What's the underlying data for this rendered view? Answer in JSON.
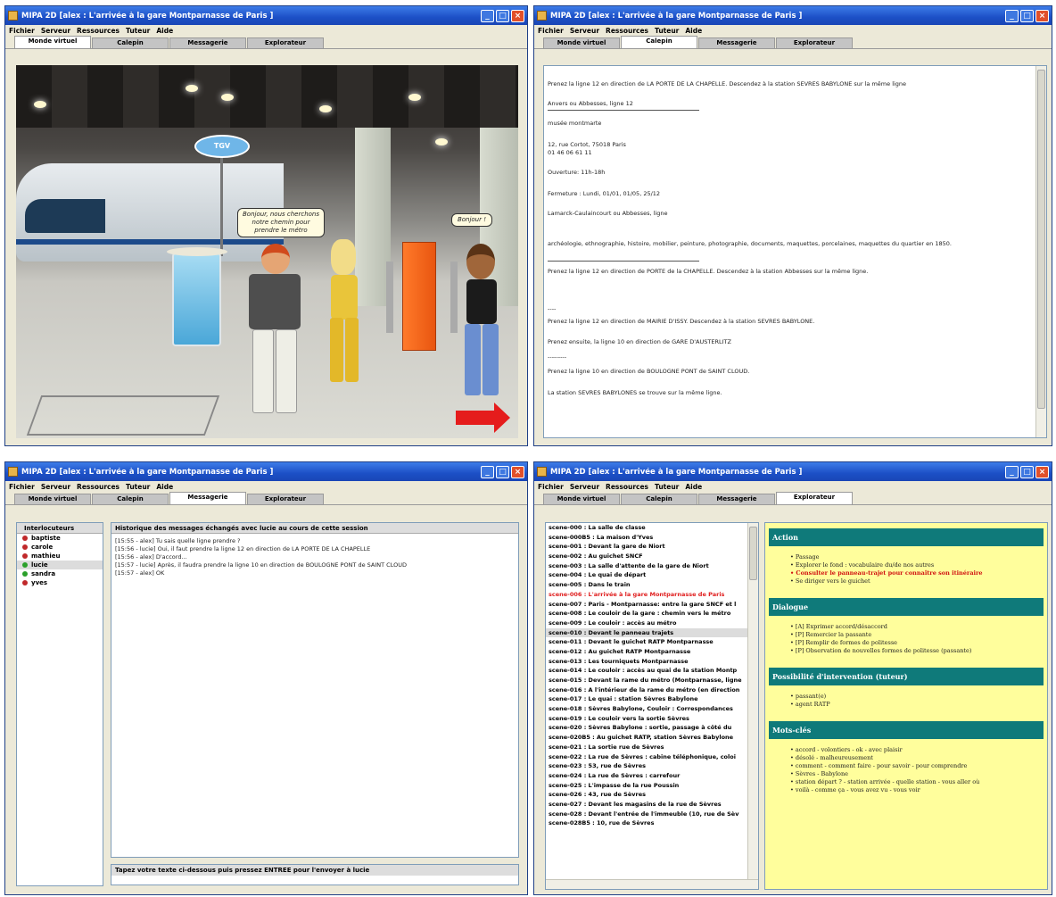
{
  "window_title": "MIPA 2D [alex : L'arrivée à la gare Montparnasse de Paris ]",
  "menu": [
    "Fichier",
    "Serveur",
    "Ressources",
    "Tuteur",
    "Aide"
  ],
  "tabs": [
    "Monde virtuel",
    "Calepin",
    "Messagerie",
    "Explorateur"
  ],
  "scene": {
    "sign": "TGV",
    "bubble_left": "Bonjour, nous cherchons notre chemin pour prendre le métro",
    "bubble_right": "Bonjour !"
  },
  "calepin": {
    "lines": [
      "Prenez la ligne 12 en direction de LA PORTE DE LA CHAPELLE. Descendez à la station SEVRES BABYLONE sur la même ligne",
      "Anvers ou Abbesses, ligne 12",
      "musée montmarte",
      "12, rue Cortot, 75018 Paris",
      "01 46 06 61 11",
      "Ouverture: 11h-18h",
      "Fermeture : Lundi, 01/01, 01/05, 25/12",
      "Lamarck-Caulaincourt ou Abbesses, ligne",
      "archéologie, ethnographie, histoire, mobilier, peinture, photographie, documents, maquettes, porcelaines, maquettes du quartier en 1850.",
      "Prenez la ligne 12 en direction de PORTE de la CHAPELLE. Descendez à la station Abbesses sur la même ligne.",
      "----",
      "Prenez la ligne 12 en direction de MAIRIE D'ISSY. Descendez à la station SEVRES BABYLONE.",
      "Prenez ensuite, la ligne 10 en direction de GARE D'AUSTERLITZ",
      "---------",
      "Prenez la ligne 10 en direction de BOULOGNE PONT de SAINT CLOUD.",
      "La station SEVRES BABYLONES se trouve sur la même ligne."
    ]
  },
  "messagerie": {
    "interlocutors_header": "Interlocuteurs",
    "interlocutors": [
      {
        "name": "baptiste",
        "color": "#c0282a"
      },
      {
        "name": "carole",
        "color": "#c0282a"
      },
      {
        "name": "mathieu",
        "color": "#c0282a"
      },
      {
        "name": "lucie",
        "color": "#2aa02a"
      },
      {
        "name": "sandra",
        "color": "#2aa02a"
      },
      {
        "name": "yves",
        "color": "#c0282a"
      }
    ],
    "history_header": "Historique des messages échangés avec lucie au cours de cette session",
    "messages": [
      "[15:55 - alex] Tu sais quelle ligne prendre ?",
      "[15:56 - lucie] Oui, il faut prendre la ligne 12 en direction de LA PORTE DE LA CHAPELLE",
      "[15:56 - alex] D'accord...",
      "[15:57 - lucie] Après, il faudra prendre la ligne 10 en direction de BOULOGNE PONT de SAINT CLOUD",
      "[15:57 - alex] OK"
    ],
    "input_header": "Tapez votre texte ci-dessous puis pressez ENTREE pour l'envoyer à lucie"
  },
  "explorateur": {
    "scenes": [
      "scene-000 : La salle de classe",
      "scene-000B5 : La maison d'Yves",
      "scene-001 : Devant la gare de Niort",
      "scene-002 : Au guichet SNCF",
      "scene-003 : La salle d'attente de la gare de Niort",
      "scene-004 : Le quai de départ",
      "scene-005 : Dans le train",
      "scene-006 : L'arrivée à la gare Montparnasse de Paris",
      "scene-007 : Paris - Montparnasse: entre la gare SNCF et l",
      "scene-008 : Le couloir de la gare : chemin vers le métro",
      "scene-009 : Le couloir : accès au métro",
      "scene-010 : Devant le panneau trajets",
      "scene-011 : Devant le guichet RATP Montparnasse",
      "scene-012 : Au guichet RATP Montparnasse",
      "scene-013 : Les tourniquets Montparnasse",
      "scene-014 : Le couloir : accès au quai de la station Montp",
      "scene-015 : Devant la rame du métro (Montparnasse, ligne",
      "scene-016 : A l'intérieur de la rame du métro (en direction",
      "scene-017 : Le quai : station Sèvres Babylone",
      "scene-018 : Sèvres Babylone, Couloir : Correspondances",
      "scene-019 : Le couloir vers la sortie Sèvres",
      "scene-020 : Sèvres Babylone : sortie, passage à côté du",
      "scene-020B5 : Au guichet RATP, station Sèvres Babylone",
      "scene-021 : La sortie rue de Sèvres",
      "scene-022 : La rue de Sèvres : cabine téléphonique, coloi",
      "scene-023 : 53, rue de Sèvres",
      "scene-024 : La rue de Sèvres : carrefour",
      "scene-025 : L'impasse de la rue Poussin",
      "scene-026 : 43, rue de Sèvres",
      "scene-027 : Devant les magasins de la rue de Sèvres",
      "scene-028 : Devant l'entrée de l'immeuble (10, rue de Sèv",
      "scene-028B5 : 10, rue de Sèvres"
    ],
    "sections": [
      {
        "title": "Action",
        "items": [
          "Passage",
          "Explorer le fond : vocabulaire du/de nos autres",
          "Consulter le panneau-trajet pour connaître son itinéraire",
          "Se diriger vers le guichet"
        ]
      },
      {
        "title": "Dialogue",
        "items": [
          "[A] Exprimer accord/désaccord",
          "[P] Remercier la passante",
          "[P] Remplir de formes de politesse",
          "[P] Observation de nouvelles formes de politesse (passante)"
        ]
      },
      {
        "title": "Possibilité d'intervention (tuteur)",
        "items": [
          "passant(e)",
          "agent RATP"
        ]
      },
      {
        "title": "Mots-clés",
        "items": [
          "accord - volontiers - ok - avec plaisir",
          "désolé - malheureusement",
          "comment - comment faire - pour savoir - pour comprendre",
          "Sèvres - Babylone",
          "station départ ? - station arrivée - quelle station - vous aller où",
          "voilà - comme ça - vous avez vu - vous voir"
        ]
      }
    ]
  }
}
